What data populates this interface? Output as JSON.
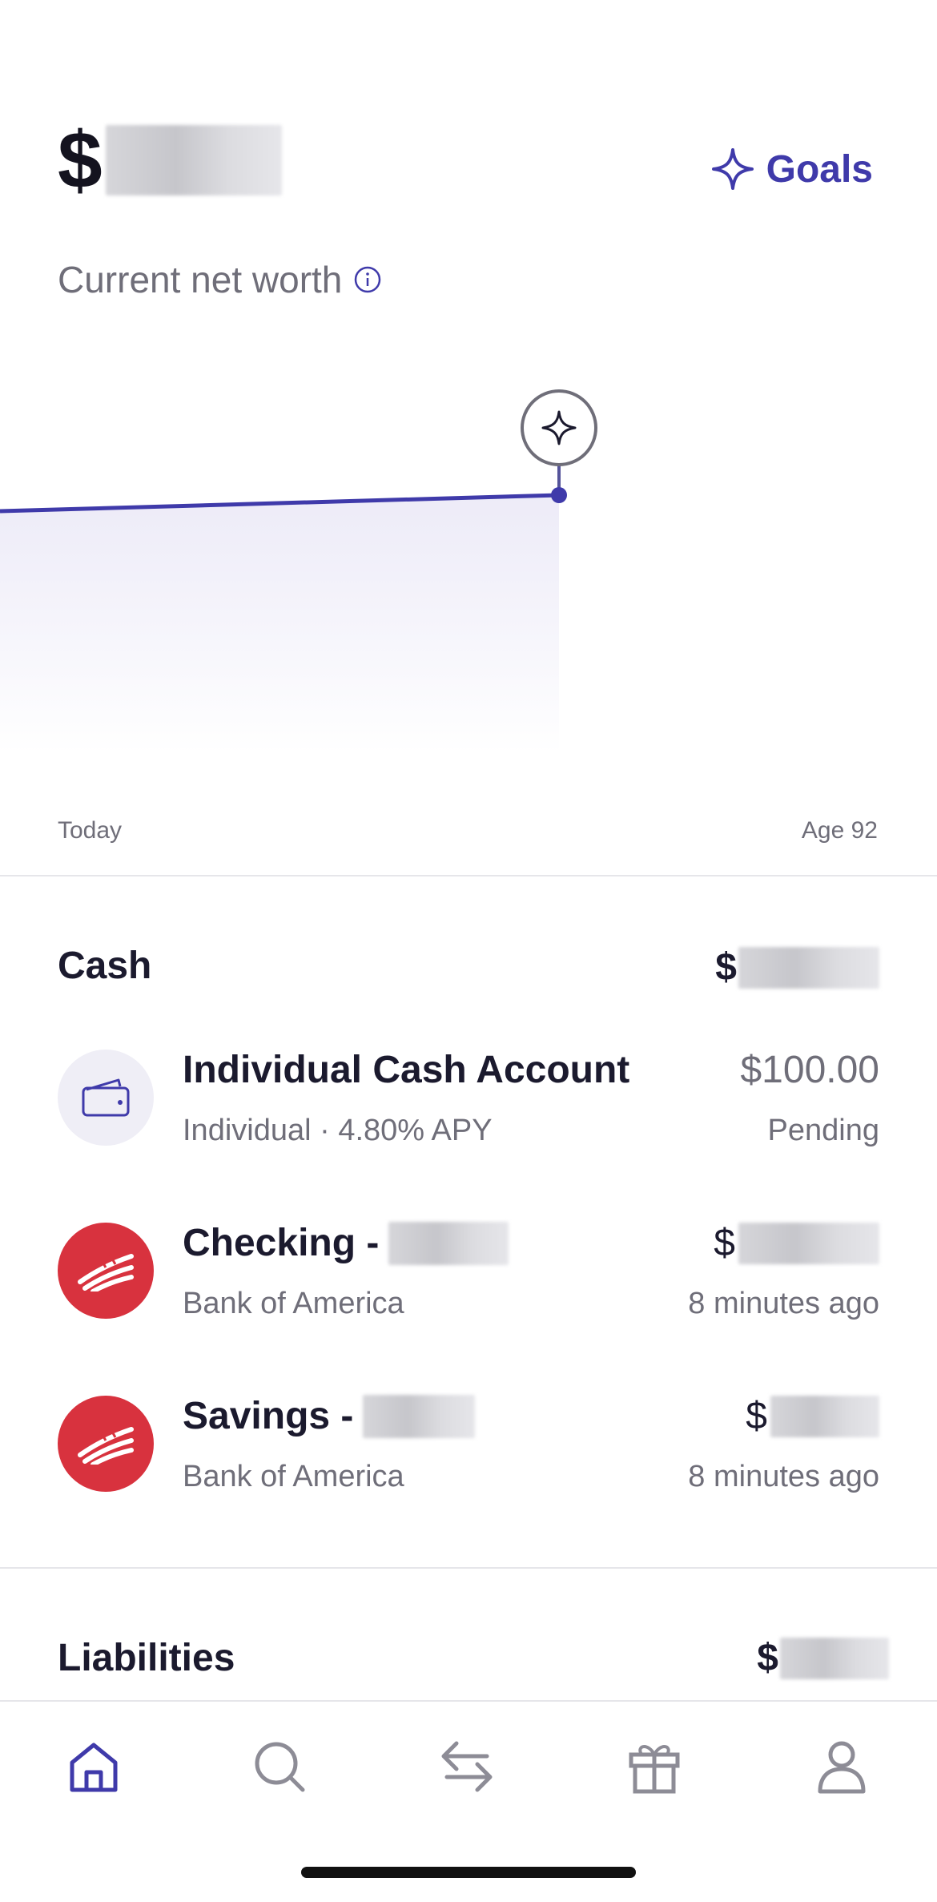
{
  "header": {
    "net_worth_currency": "$",
    "net_worth_label": "Current net worth",
    "goals_label": "Goals"
  },
  "chart_data": {
    "type": "area",
    "x_labels": [
      "Today",
      "Age 92"
    ],
    "title": "",
    "xlabel": "",
    "ylabel": "",
    "grid": false
  },
  "cash": {
    "title": "Cash",
    "total_currency": "$",
    "accounts": [
      {
        "name": "Individual Cash Account",
        "subtitle": "Individual · 4.80% APY",
        "amount": "$100.00",
        "status": "Pending",
        "icon": "wallet-icon"
      },
      {
        "name": "Checking -",
        "subtitle": "Bank of America",
        "amount_currency": "$",
        "status": "8 minutes ago",
        "icon": "bank-of-america-logo"
      },
      {
        "name": "Savings -",
        "subtitle": "Bank of America",
        "amount_currency": "$",
        "status": "8 minutes ago",
        "icon": "bank-of-america-logo"
      }
    ]
  },
  "liabilities": {
    "title": "Liabilities",
    "total_currency": "$"
  },
  "tabbar": {
    "tabs": [
      "home-icon",
      "search-icon",
      "transfer-icon",
      "gift-icon",
      "profile-icon"
    ],
    "active_color": "#3f3aaa",
    "inactive_color": "#8d8c96"
  },
  "colors": {
    "accent": "#3f3aaa",
    "boa_red": "#d8323e"
  }
}
